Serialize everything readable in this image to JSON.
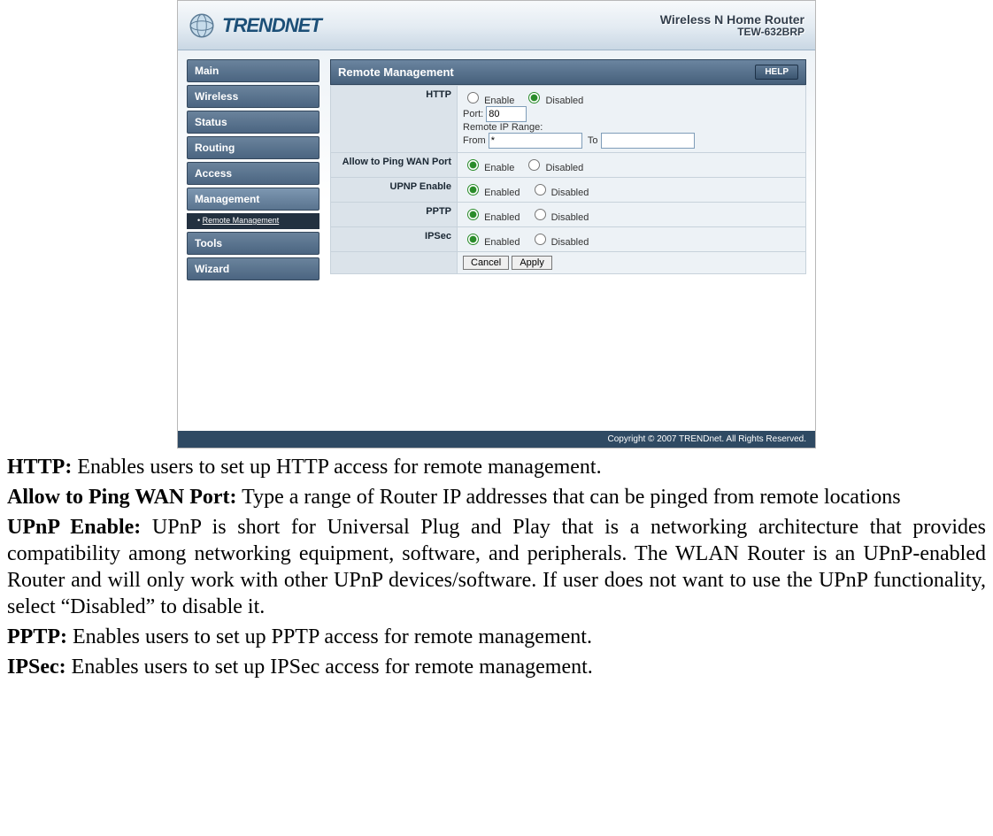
{
  "header": {
    "brand": "TRENDNET",
    "product_line": "Wireless N Home Router",
    "model": "TEW-632BRP"
  },
  "sidebar": {
    "items": [
      {
        "label": "Main"
      },
      {
        "label": "Wireless"
      },
      {
        "label": "Status"
      },
      {
        "label": "Routing"
      },
      {
        "label": "Access"
      },
      {
        "label": "Management"
      },
      {
        "label": "Tools"
      },
      {
        "label": "Wizard"
      }
    ],
    "sub_nav": {
      "bullet": "•",
      "label": "Remote Management"
    }
  },
  "panel": {
    "title": "Remote Management",
    "help": "HELP",
    "rows": {
      "http": {
        "label": "HTTP",
        "enable": "Enable",
        "disabled": "Disabled",
        "port_label": "Port:",
        "port_value": "80",
        "range_label": "Remote IP Range:",
        "from_label": "From",
        "from_value": "*",
        "to_label": "To",
        "to_value": ""
      },
      "ping": {
        "label": "Allow to Ping WAN Port",
        "enable": "Enable",
        "disabled": "Disabled"
      },
      "upnp": {
        "label": "UPNP Enable",
        "enabled": "Enabled",
        "disabled": "Disabled"
      },
      "pptp": {
        "label": "PPTP",
        "enabled": "Enabled",
        "disabled": "Disabled"
      },
      "ipsec": {
        "label": "IPSec",
        "enabled": "Enabled",
        "disabled": "Disabled"
      },
      "actions": {
        "cancel": "Cancel",
        "apply": "Apply"
      }
    }
  },
  "footer": {
    "copyright": "Copyright © 2007 TRENDnet. All Rights Reserved."
  },
  "descriptions": {
    "http": {
      "term": "HTTP:",
      "text": " Enables users to set up HTTP access for remote management."
    },
    "ping": {
      "term": "Allow to Ping WAN Port:",
      "text": " Type a range of Router IP addresses that can be pinged from remote locations"
    },
    "upnp": {
      "term": "UPnP Enable:",
      "text": " UPnP is short for Universal Plug and Play that is a networking architecture that provides compatibility among networking equipment, software, and peripherals. The WLAN Router is an UPnP-enabled Router and will only work with other UPnP devices/software. If user does not want to use the UPnP functionality, select “Disabled” to disable it."
    },
    "pptp": {
      "term": "PPTP:",
      "text": " Enables users to set up PPTP access for remote management."
    },
    "ipsec": {
      "term": "IPSec:",
      "text": " Enables users to set up IPSec access for remote management."
    }
  }
}
